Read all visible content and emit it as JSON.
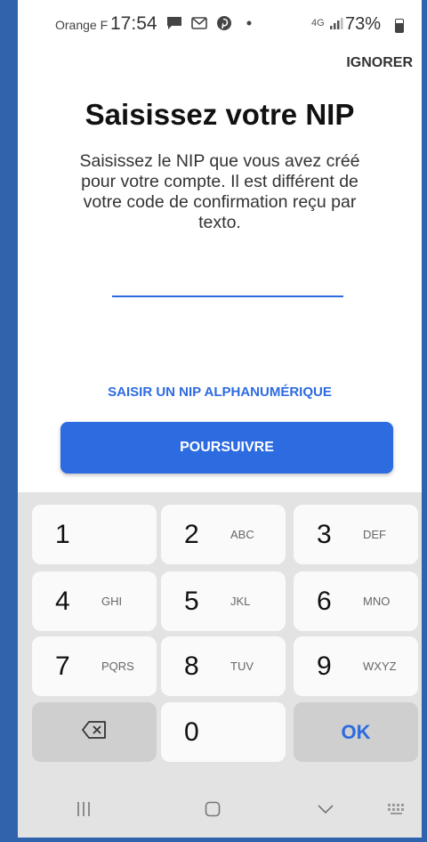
{
  "status_bar": {
    "carrier": "Orange F",
    "time": "17:54",
    "network": "4G",
    "battery": "73%",
    "battery_level": 0.73,
    "icons": [
      "chat-icon",
      "mail-icon",
      "pinterest-icon",
      "dot-icon"
    ]
  },
  "header": {
    "ignore_label": "IGNORER"
  },
  "main": {
    "title": "Saisissez votre NIP",
    "description": "Saisissez le NIP que vous avez créé pour votre compte. Il est différent de votre code de confirmation reçu par texto.",
    "pin_value": "",
    "alpha_link": "SAISIR UN NIP ALPHANUMÉRIQUE",
    "continue_label": "POURSUIVRE"
  },
  "keyboard": {
    "keys": [
      {
        "num": "1",
        "letters": ""
      },
      {
        "num": "2",
        "letters": "ABC"
      },
      {
        "num": "3",
        "letters": "DEF"
      },
      {
        "num": "4",
        "letters": "GHI"
      },
      {
        "num": "5",
        "letters": "JKL"
      },
      {
        "num": "6",
        "letters": "MNO"
      },
      {
        "num": "7",
        "letters": "PQRS"
      },
      {
        "num": "8",
        "letters": "TUV"
      },
      {
        "num": "9",
        "letters": "WXYZ"
      },
      {
        "num": "0",
        "letters": ""
      }
    ],
    "ok_label": "OK",
    "backspace_icon": "backspace-icon"
  },
  "nav": {
    "icons": [
      "recents-icon",
      "home-icon",
      "back-icon",
      "keyboard-icon"
    ]
  },
  "colors": {
    "accent": "#2d6be0",
    "frame": "#2f64ad",
    "keyboard_bg": "#e3e3e3"
  }
}
